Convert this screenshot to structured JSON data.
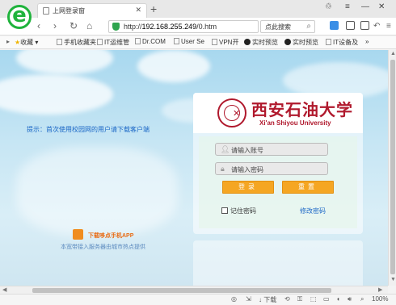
{
  "tab": {
    "title": "上网登录窗"
  },
  "nav": {
    "url_prefix": "http://",
    "url_host": "192.168.255.249",
    "url_path": "/0.htm",
    "search_label": "点此搜索"
  },
  "bookmarks": [
    "收藏",
    "手机收藏夹",
    "IT运维管",
    "Dr.COM",
    "User Se",
    "VPN开",
    "实时预览",
    "实时预览",
    "IT设备及"
  ],
  "page": {
    "hint": "提示：首次使用校园网的用户请下载客户端",
    "app_link": "下载哆点手机APP",
    "app_desc": "本宽带接入服务器由城市热点提供",
    "university_cn": "西安石油大学",
    "university_en": "Xi'an Shiyou University",
    "username_placeholder": "请输入账号",
    "password_placeholder": "请输入密码",
    "login_label": "登录",
    "reset_label": "重置",
    "remember_label": "记住密码",
    "change_password_label": "修改密码"
  },
  "status": {
    "download": "下载",
    "zoom": "100%"
  },
  "colors": {
    "accent": "#f5a623",
    "brand": "#b0192d",
    "link": "#1a66c6",
    "browser_green": "#1fb33c"
  }
}
